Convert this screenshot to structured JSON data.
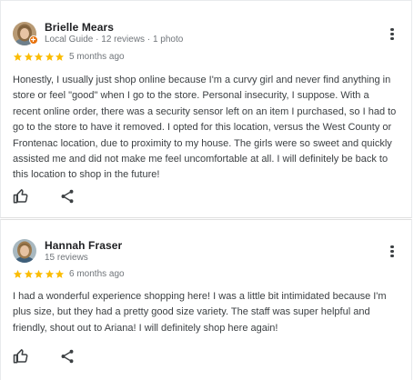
{
  "reviews": [
    {
      "name": "Brielle Mears",
      "meta": "Local Guide · 12 reviews · 1 photo",
      "date": "5 months ago",
      "stars": 5,
      "local_guide": true,
      "text": "Honestly, I usually just shop online because I'm a curvy girl and never find anything in store or feel \"good\" when I go to the store. Personal insecurity, I suppose. With a recent online order, there was a security sensor left on an item I purchased, so I had to go to the store to have it removed. I opted for this location, versus the West County or Frontenac location, due to proximity to my house. The girls were so sweet and quickly assisted me and did not make me feel uncomfortable at all. I will definitely be back to this location to shop in the future!"
    },
    {
      "name": "Hannah Fraser",
      "meta": "15 reviews",
      "date": "6 months ago",
      "stars": 5,
      "local_guide": false,
      "text": "I had a wonderful experience shopping here! I was a little bit intimidated because I'm plus size, but they had a pretty good size variety. The staff was super helpful and friendly, shout out to Ariana! I will definitely shop here again!"
    }
  ],
  "icons": {
    "like": "thumb-up-icon",
    "share": "share-icon",
    "more": "more-vert-icon",
    "star": "star-icon"
  },
  "colors": {
    "star": "#fbbc04",
    "badge": "#e8710a"
  }
}
